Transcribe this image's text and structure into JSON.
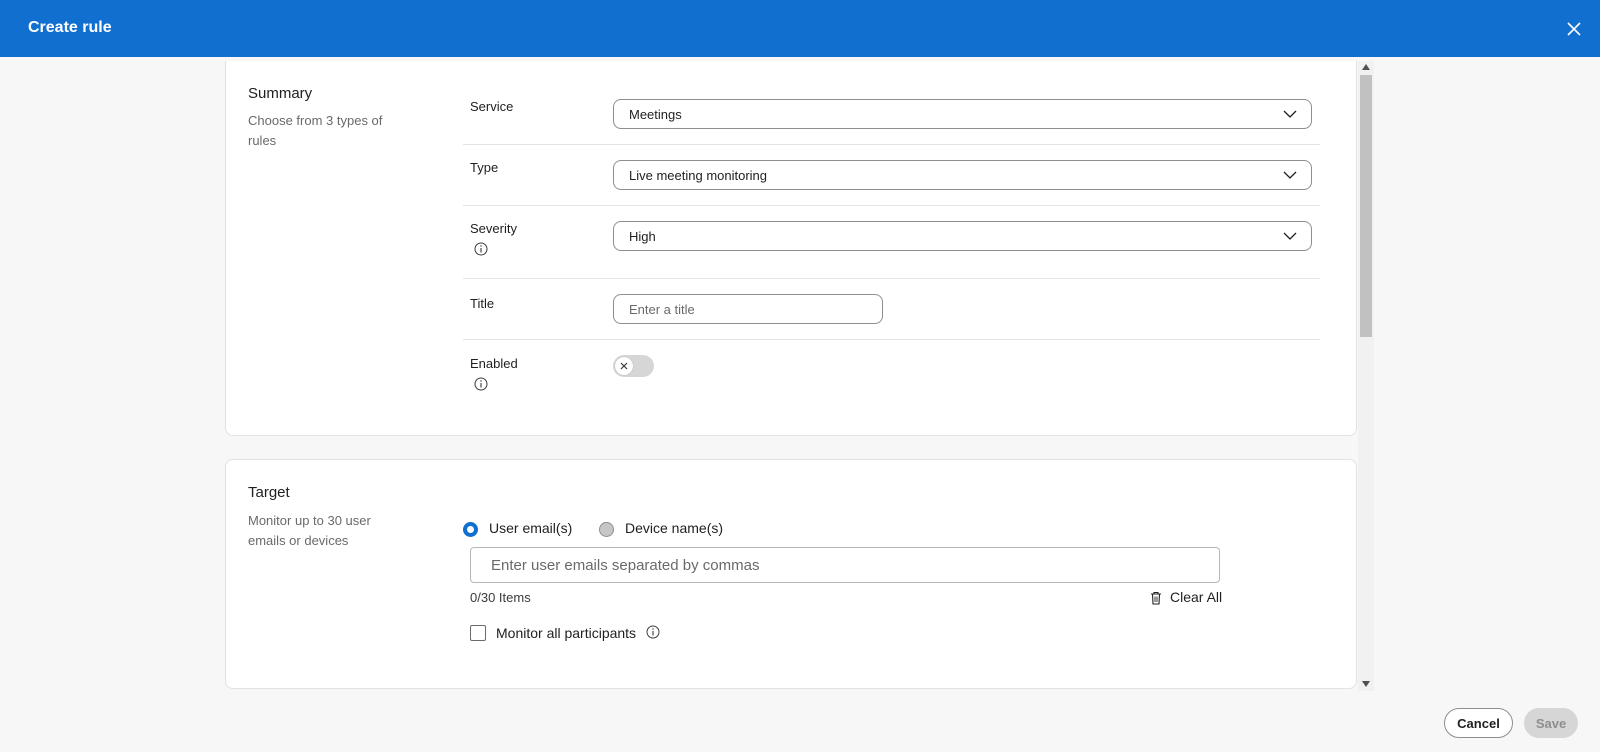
{
  "header": {
    "title": "Create rule",
    "close_icon": "close-icon"
  },
  "summary": {
    "title": "Summary",
    "description": "Choose from 3 types of rules",
    "service": {
      "label": "Service",
      "value": "Meetings"
    },
    "type": {
      "label": "Type",
      "value": "Live meeting monitoring"
    },
    "severity": {
      "label": "Severity",
      "value": "High",
      "icon": "info-icon"
    },
    "title_field": {
      "label": "Title",
      "placeholder": "Enter a title"
    },
    "enabled": {
      "label": "Enabled",
      "state": "off",
      "icon": "info-icon"
    }
  },
  "target": {
    "title": "Target",
    "description": "Monitor up to 30 user emails or devices",
    "options": [
      {
        "label": "User email(s)",
        "selected": true
      },
      {
        "label": "Device name(s)",
        "selected": false
      }
    ],
    "email_placeholder": "Enter user emails separated by commas",
    "count": "0/30 Items",
    "clear_all": "Clear All",
    "monitor_all": "Monitor all participants"
  },
  "footer": {
    "cancel": "Cancel",
    "save": "Save"
  },
  "colors": {
    "brand": "#1170cf",
    "toggle_off": "#d6d6d6",
    "save_disabled": "#d6d6d6"
  }
}
